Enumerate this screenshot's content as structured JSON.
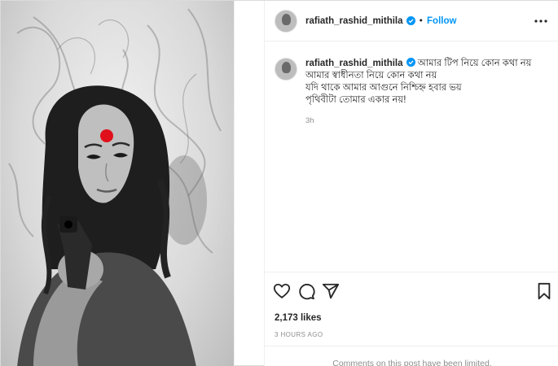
{
  "post": {
    "username": "rafiath_rashid_mithila",
    "follow_label": "Follow",
    "separator": "•",
    "more_icon": "more-options-icon"
  },
  "caption": {
    "username": "rafiath_rashid_mithila",
    "lines": [
      "আমার টিপ নিয়ে কোন কথা নয়",
      "আমার স্বাধীনতা নিয়ে কোন কথা নয়",
      "যদি থাকে আমার আগুনে নিশ্চিহ্ন হবার ভয়",
      "পৃথিবীটা তোমার একার নয়!"
    ],
    "time": "3h"
  },
  "actions": {
    "like_icon": "heart-icon",
    "comment_icon": "comment-icon",
    "share_icon": "share-icon",
    "save_icon": "bookmark-icon"
  },
  "stats": {
    "likes": "2,173 likes",
    "posted_ago": "3 HOURS AGO"
  },
  "comments_notice": "Comments on this post have been limited.",
  "colors": {
    "link_blue": "#0095f6",
    "bindi_red": "#e0101a",
    "muted_text": "#8e8e8e"
  }
}
